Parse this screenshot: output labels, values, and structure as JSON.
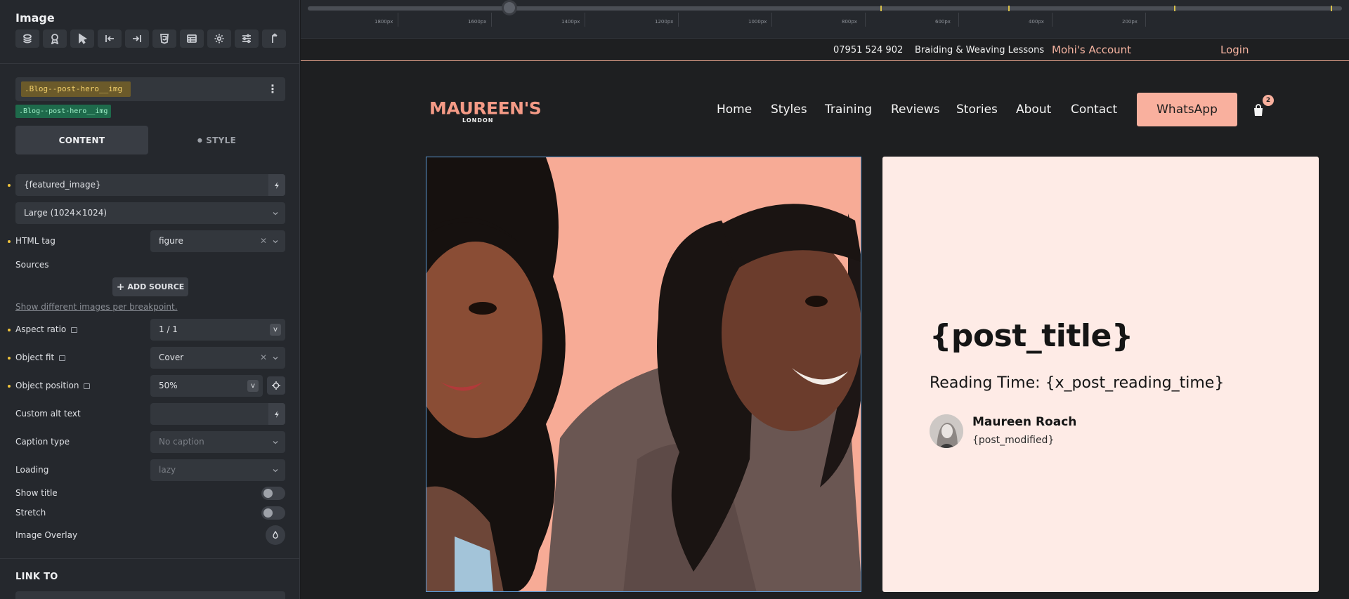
{
  "panel": {
    "title": "Image",
    "toolbar_icons": [
      "layers-icon",
      "award-icon",
      "cursor-icon",
      "align-left-icon",
      "align-right-icon",
      "html5-icon",
      "table-icon",
      "gear-icon",
      "sliders-icon",
      "pin-icon"
    ],
    "class_name": ".Blog--post-hero__img",
    "class_badge": ".Blog--post-hero__img",
    "tabs": {
      "content": "CONTENT",
      "style": "STYLE"
    },
    "image_source": "{featured_image}",
    "image_size": "Large (1024×1024)",
    "html_tag": {
      "label": "HTML tag",
      "value": "figure"
    },
    "sources": {
      "label": "Sources",
      "button": "ADD SOURCE",
      "note": "Show different images per breakpoint."
    },
    "aspect_ratio": {
      "label": "Aspect ratio",
      "value": "1 / 1"
    },
    "object_fit": {
      "label": "Object fit",
      "value": "Cover"
    },
    "object_position": {
      "label": "Object position",
      "value": "50%"
    },
    "alt_text": {
      "label": "Custom alt text",
      "value": ""
    },
    "caption_type": {
      "label": "Caption type",
      "value": "No caption"
    },
    "loading": {
      "label": "Loading",
      "value": "lazy"
    },
    "show_title": {
      "label": "Show title",
      "on": false
    },
    "stretch": {
      "label": "Stretch",
      "on": false
    },
    "overlay": {
      "label": "Image Overlay"
    },
    "link_to": "LINK TO",
    "unit_badge": "v"
  },
  "ruler": {
    "labels": [
      "1800px",
      "1600px",
      "1400px",
      "1200px",
      "1000px",
      "800px",
      "600px",
      "400px",
      "200px"
    ]
  },
  "site": {
    "topbar": {
      "phone": "07951 524 902",
      "lessons": "Braiding & Weaving Lessons",
      "account": "Mohi's Account",
      "login": "Login"
    },
    "logo": {
      "main": "MAUREEN'S",
      "sub": "LONDON"
    },
    "nav": [
      "Home",
      "Styles",
      "Training",
      "Reviews",
      "Stories",
      "About",
      "Contact"
    ],
    "cta": "WhatsApp",
    "cart_count": "2",
    "hero": {
      "title": "{post_title}",
      "reading_time": "Reading Time: {x_post_reading_time}",
      "author": "Maureen Roach",
      "modified": "{post_modified}"
    }
  },
  "colors": {
    "accent": "#f9b09e",
    "logo": "#f49a86",
    "panel_bg": "#25282d",
    "card_bg": "#feebe6",
    "class_tag": "#f1cf6b",
    "class_badge": "#1e6a4b"
  }
}
